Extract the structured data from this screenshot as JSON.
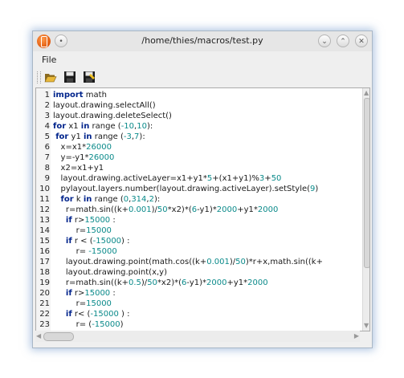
{
  "window": {
    "title": "/home/thies/macros/test.py",
    "controls": {
      "stick": "•",
      "minimize": "⌄",
      "maximize": "⌃",
      "close": "✕"
    }
  },
  "menu": {
    "file": "File"
  },
  "toolbar": {
    "open_icon": "folder-open-icon",
    "save_icon": "save-icon",
    "save_as_icon": "save-as-icon"
  },
  "colors": {
    "keyword": "#00248c",
    "number": "#0a8a8a",
    "text": "#1a1a1a"
  },
  "editor": {
    "lines": [
      {
        "n": "1",
        "tokens": [
          {
            "t": "import",
            "c": "kw"
          },
          {
            "t": " math"
          }
        ]
      },
      {
        "n": "2",
        "tokens": [
          {
            "t": "layout.drawing.selectAll()"
          }
        ]
      },
      {
        "n": "3",
        "tokens": [
          {
            "t": "layout.drawing.deleteSelect()"
          }
        ]
      },
      {
        "n": "4",
        "tokens": [
          {
            "t": "for",
            "c": "kw"
          },
          {
            "t": " x1 "
          },
          {
            "t": "in",
            "c": "kw"
          },
          {
            "t": " range ("
          },
          {
            "t": "-10",
            "c": "num"
          },
          {
            "t": ","
          },
          {
            "t": "10",
            "c": "num"
          },
          {
            "t": "):"
          }
        ]
      },
      {
        "n": "5",
        "tokens": [
          {
            "t": " "
          },
          {
            "t": "for",
            "c": "kw"
          },
          {
            "t": " y1 "
          },
          {
            "t": "in",
            "c": "kw"
          },
          {
            "t": " range ("
          },
          {
            "t": "-3",
            "c": "num"
          },
          {
            "t": ","
          },
          {
            "t": "7",
            "c": "num"
          },
          {
            "t": "):"
          }
        ]
      },
      {
        "n": "6",
        "tokens": [
          {
            "t": "   x=x1*"
          },
          {
            "t": "26000",
            "c": "num"
          }
        ]
      },
      {
        "n": "7",
        "tokens": [
          {
            "t": "   y=-y1*"
          },
          {
            "t": "26000",
            "c": "num"
          }
        ]
      },
      {
        "n": "8",
        "tokens": [
          {
            "t": "   x2=x1+y1"
          }
        ]
      },
      {
        "n": "9",
        "tokens": [
          {
            "t": "   layout.drawing.activeLayer=x1+y1*"
          },
          {
            "t": "5",
            "c": "num"
          },
          {
            "t": "+(x1+y1)%"
          },
          {
            "t": "3",
            "c": "num"
          },
          {
            "t": "+"
          },
          {
            "t": "50",
            "c": "num"
          }
        ]
      },
      {
        "n": "10",
        "tokens": [
          {
            "t": "   pylayout.layers.number(layout.drawing.activeLayer).setStyle("
          },
          {
            "t": "9",
            "c": "num"
          },
          {
            "t": ")"
          }
        ]
      },
      {
        "n": "11",
        "tokens": [
          {
            "t": "   "
          },
          {
            "t": "for",
            "c": "kw"
          },
          {
            "t": " k "
          },
          {
            "t": "in",
            "c": "kw"
          },
          {
            "t": " range ("
          },
          {
            "t": "0",
            "c": "num"
          },
          {
            "t": ","
          },
          {
            "t": "314",
            "c": "num"
          },
          {
            "t": ","
          },
          {
            "t": "2",
            "c": "num"
          },
          {
            "t": "):"
          }
        ]
      },
      {
        "n": "12",
        "tokens": [
          {
            "t": "     r=math.sin((k+"
          },
          {
            "t": "0.001",
            "c": "num"
          },
          {
            "t": ")/"
          },
          {
            "t": "50",
            "c": "num"
          },
          {
            "t": "*x2)*("
          },
          {
            "t": "6",
            "c": "num"
          },
          {
            "t": "-y1)*"
          },
          {
            "t": "2000",
            "c": "num"
          },
          {
            "t": "+y1*"
          },
          {
            "t": "2000",
            "c": "num"
          }
        ]
      },
      {
        "n": "13",
        "tokens": [
          {
            "t": "     "
          },
          {
            "t": "if",
            "c": "kw"
          },
          {
            "t": " r>"
          },
          {
            "t": "15000",
            "c": "num"
          },
          {
            "t": " :"
          }
        ]
      },
      {
        "n": "14",
        "tokens": [
          {
            "t": "         r="
          },
          {
            "t": "15000",
            "c": "num"
          }
        ]
      },
      {
        "n": "15",
        "tokens": [
          {
            "t": "     "
          },
          {
            "t": "if",
            "c": "kw"
          },
          {
            "t": " r < ("
          },
          {
            "t": "-15000",
            "c": "num"
          },
          {
            "t": ") :"
          }
        ]
      },
      {
        "n": "16",
        "tokens": [
          {
            "t": "         r= "
          },
          {
            "t": "-15000",
            "c": "num"
          }
        ]
      },
      {
        "n": "17",
        "tokens": [
          {
            "t": "     layout.drawing.point(math.cos((k+"
          },
          {
            "t": "0.001",
            "c": "num"
          },
          {
            "t": ")/"
          },
          {
            "t": "50",
            "c": "num"
          },
          {
            "t": ")*r+x,math.sin((k+"
          }
        ]
      },
      {
        "n": "18",
        "tokens": [
          {
            "t": "     layout.drawing.point(x,y)"
          }
        ]
      },
      {
        "n": "19",
        "tokens": [
          {
            "t": "     r=math.sin((k+"
          },
          {
            "t": "0.5",
            "c": "num"
          },
          {
            "t": ")/"
          },
          {
            "t": "50",
            "c": "num"
          },
          {
            "t": "*x2)*("
          },
          {
            "t": "6",
            "c": "num"
          },
          {
            "t": "-y1)*"
          },
          {
            "t": "2000",
            "c": "num"
          },
          {
            "t": "+y1*"
          },
          {
            "t": "2000",
            "c": "num"
          }
        ]
      },
      {
        "n": "20",
        "tokens": [
          {
            "t": "     "
          },
          {
            "t": "if",
            "c": "kw"
          },
          {
            "t": " r>"
          },
          {
            "t": "15000",
            "c": "num"
          },
          {
            "t": " :"
          }
        ]
      },
      {
        "n": "21",
        "tokens": [
          {
            "t": "         r="
          },
          {
            "t": "15000",
            "c": "num"
          }
        ]
      },
      {
        "n": "22",
        "tokens": [
          {
            "t": "     "
          },
          {
            "t": "if",
            "c": "kw"
          },
          {
            "t": " r< ("
          },
          {
            "t": "-15000",
            "c": "num"
          },
          {
            "t": " ) :"
          }
        ]
      },
      {
        "n": "23",
        "tokens": [
          {
            "t": "         r= ("
          },
          {
            "t": "-15000",
            "c": "num"
          },
          {
            "t": ")"
          }
        ]
      }
    ]
  }
}
